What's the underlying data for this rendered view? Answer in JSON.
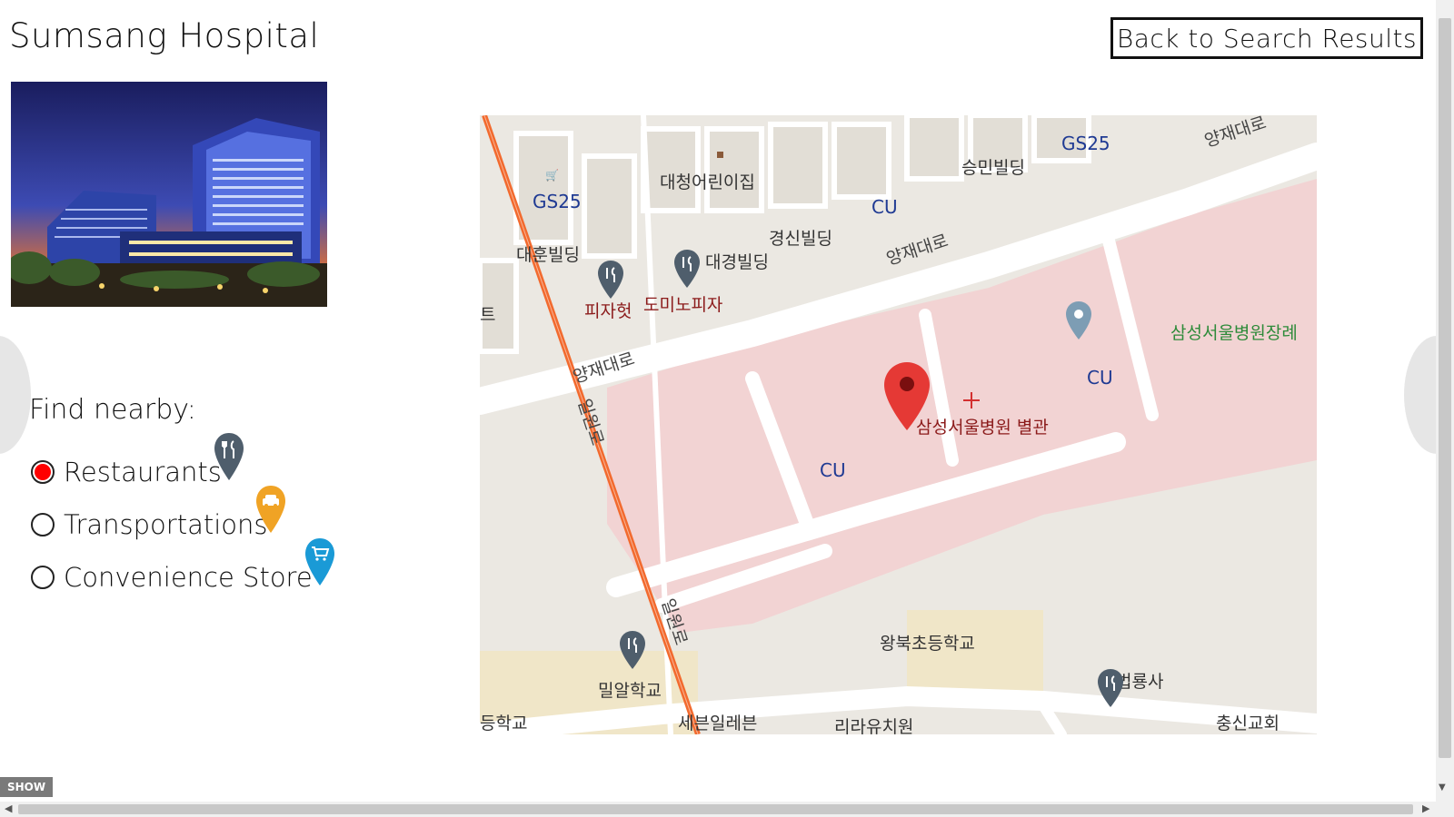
{
  "page": {
    "title": "Sumsang Hospital",
    "back_label": "Back to Search Results"
  },
  "nearby": {
    "heading": "Find nearby:",
    "options": [
      {
        "label": "Restaurants",
        "selected": true,
        "pin_color": "#4f5e6c",
        "icon": "fork-knife-icon"
      },
      {
        "label": "Transportations",
        "selected": false,
        "pin_color": "#f0a325",
        "icon": "car-icon"
      },
      {
        "label": "Convenience Store",
        "selected": false,
        "pin_color": "#1a9ad6",
        "icon": "cart-icon"
      }
    ]
  },
  "map": {
    "labels": {
      "daecheong": "대청어린이집",
      "seungmin": "승민빌딩",
      "gs25_a": "GS25",
      "gs25_b": "GS25",
      "cu_a": "CU",
      "cu_b": "CU",
      "cu_c": "CU",
      "gyeongsin": "경신빌딩",
      "daehun": "대훈빌딩",
      "daegyeong": "대경빌딩",
      "pizzahut": "피자헛",
      "dominos": "도미노피자",
      "yangjae1": "양재대로",
      "yangjae2": "양재대로",
      "yangjae3": "양재대로",
      "irwon1": "일원로",
      "irwon2": "일원로",
      "annex": "삼성서울병원 별관",
      "funeral": "삼성서울병원장례",
      "wangbuk": "왕북초등학교",
      "miral": "밀알학교",
      "seven": "세븐일레븐",
      "beomyong": "법룡사",
      "church": "충신교회",
      "t_edge": "트",
      "school_edge": "등학교",
      "kinder": "리라유치원"
    },
    "colors": {
      "hospital_area": "#f2d3d3",
      "road": "#ffffff",
      "land": "#ebe8e2",
      "arterial": "#f26a2e",
      "school_area": "#f0e6c8",
      "selected_pin": "#e53935"
    }
  },
  "ui": {
    "show_label": "SHOW",
    "up_arrow": "▲",
    "down_arrow": "▼",
    "left_arrow": "◀",
    "right_arrow": "▶"
  }
}
